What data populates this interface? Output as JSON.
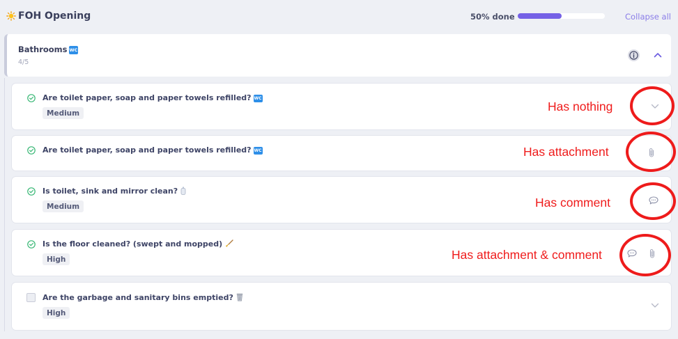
{
  "header": {
    "title": "FOH Opening",
    "progress_text": "50% done",
    "progress_fraction": 0.5,
    "collapse_label": "Collapse all",
    "accent_color": "#7561e6"
  },
  "section": {
    "title": "Bathrooms",
    "emoji_badge": "WC",
    "count": "4/5",
    "info_icon": "info-circle-icon",
    "toggle_icon": "chevron-up-icon"
  },
  "tasks": [
    {
      "text": "Are toilet paper, soap and paper towels refilled?",
      "emoji": "WC",
      "priority": "Medium",
      "done": true,
      "actions": [
        "chevron-down-icon"
      ]
    },
    {
      "text": "Are toilet paper, soap and paper towels refilled?",
      "emoji": "WC",
      "done": true,
      "actions": [
        "paperclip-icon"
      ]
    },
    {
      "text": "Is toilet, sink and mirror clean?",
      "emoji": "soap-bottle-icon",
      "priority": "Medium",
      "done": true,
      "actions": [
        "comment-icon"
      ]
    },
    {
      "text": "Is the floor cleaned? (swept and mopped)",
      "emoji": "broom-icon",
      "priority": "High",
      "done": true,
      "actions": [
        "comment-icon",
        "paperclip-icon"
      ]
    },
    {
      "text": "Are the garbage and sanitary bins emptied?",
      "emoji": "wastebasket-icon",
      "priority": "High",
      "done": false,
      "actions": [
        "chevron-down-icon"
      ]
    }
  ],
  "annotations": [
    "Has nothing",
    "Has attachment",
    "Has comment",
    "Has attachment & comment"
  ]
}
